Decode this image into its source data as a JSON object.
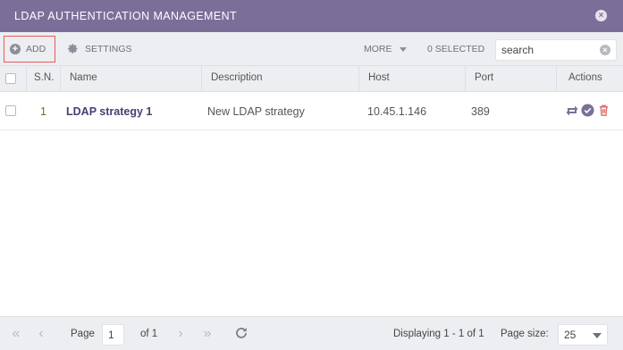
{
  "window": {
    "title": "LDAP AUTHENTICATION MANAGEMENT"
  },
  "toolbar": {
    "add_label": "ADD",
    "settings_label": "SETTINGS",
    "more_label": "MORE",
    "selected_label": "0 SELECTED",
    "search_placeholder": "search"
  },
  "table": {
    "columns": [
      "S.N.",
      "Name",
      "Description",
      "Host",
      "Port",
      "Actions"
    ],
    "rows": [
      {
        "sn": "1",
        "name": "LDAP strategy 1",
        "description": "New LDAP strategy",
        "host": "10.45.1.146",
        "port": "389"
      }
    ],
    "actions": [
      "sync-icon",
      "check-icon",
      "trash-icon"
    ]
  },
  "footer": {
    "page_label": "Page",
    "page_value": "1",
    "of_label": "of 1",
    "displaying": "Displaying 1 - 1 of 1",
    "page_size_label": "Page size:",
    "page_size_value": "25"
  },
  "colors": {
    "titlebar": "#7b6f9a",
    "highlight_border": "#e85a5a",
    "name_link": "#4a3d70",
    "delete": "#e07070",
    "check": "#7b6f9a"
  }
}
